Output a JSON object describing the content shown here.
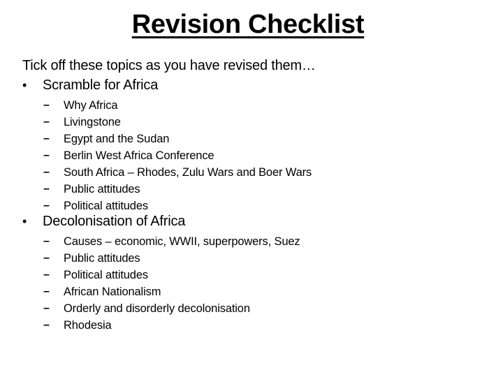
{
  "title": "Revision Checklist",
  "intro": "Tick off these topics as you have revised them…",
  "bullet_glyph": "•",
  "dash_glyph": "–",
  "sections": [
    {
      "heading": "Scramble for Africa",
      "items": [
        "Why Africa",
        "Livingstone",
        "Egypt and the Sudan",
        "Berlin West Africa Conference",
        "South Africa – Rhodes, Zulu Wars and Boer Wars",
        "Public attitudes",
        "Political attitudes"
      ]
    },
    {
      "heading": "Decolonisation of Africa",
      "items": [
        "Causes – economic, WWII, superpowers, Suez",
        "Public attitudes",
        "Political attitudes",
        "African Nationalism",
        "Orderly and disorderly decolonisation",
        "Rhodesia"
      ]
    }
  ]
}
